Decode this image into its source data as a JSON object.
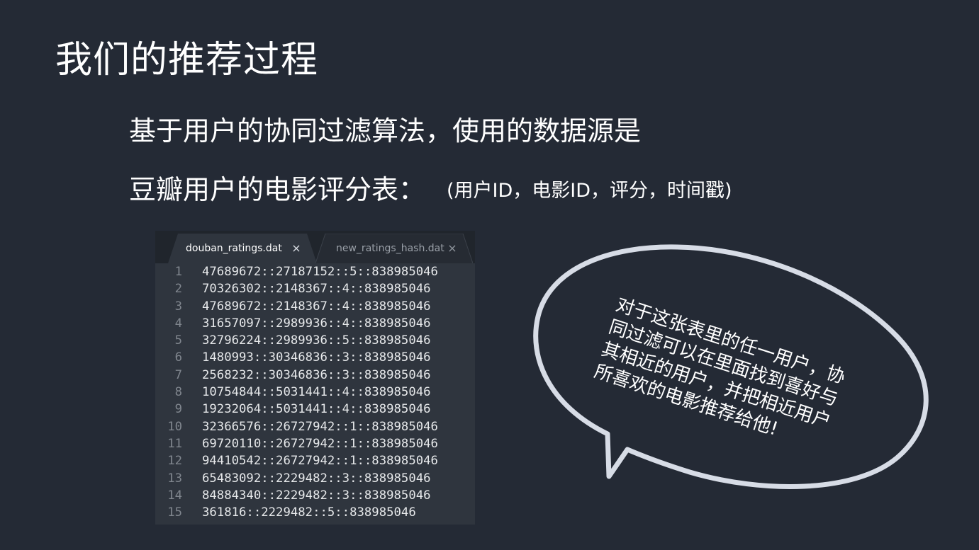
{
  "slide": {
    "title": "我们的推荐过程",
    "line1": "基于用户的协同过滤算法，使用的数据源是",
    "line2_main": "豆瓣用户的电影评分表：",
    "line2_note": "(用户ID，电影ID，评分，时间戳)"
  },
  "editor": {
    "tabs": [
      {
        "label": "douban_ratings.dat",
        "close": "×",
        "active": true
      },
      {
        "label": "new_ratings_hash.dat",
        "close": "×",
        "active": false
      }
    ],
    "lines": [
      {
        "num": "1",
        "text": "47689672::27187152::5::838985046"
      },
      {
        "num": "2",
        "text": "70326302::2148367::4::838985046"
      },
      {
        "num": "3",
        "text": "47689672::2148367::4::838985046"
      },
      {
        "num": "4",
        "text": "31657097::2989936::4::838985046"
      },
      {
        "num": "5",
        "text": "32796224::2989936::5::838985046"
      },
      {
        "num": "6",
        "text": "1480993::30346836::3::838985046"
      },
      {
        "num": "7",
        "text": "2568232::30346836::3::838985046"
      },
      {
        "num": "8",
        "text": "10754844::5031441::4::838985046"
      },
      {
        "num": "9",
        "text": "19232064::5031441::4::838985046"
      },
      {
        "num": "10",
        "text": "32366576::26727942::1::838985046"
      },
      {
        "num": "11",
        "text": "69720110::26727942::1::838985046"
      },
      {
        "num": "12",
        "text": "94410542::26727942::1::838985046"
      },
      {
        "num": "13",
        "text": "65483092::2229482::3::838985046"
      },
      {
        "num": "14",
        "text": "84884340::2229482::3::838985046"
      },
      {
        "num": "15",
        "text": "361816::2229482::5::838985046"
      }
    ]
  },
  "bubble": {
    "lines": [
      "对于这张表里的任一用户，协",
      "同过滤可以在里面找到喜好与",
      "其相近的用户，并把相近用户",
      "所喜欢的电影推荐给他!"
    ]
  },
  "colors": {
    "background": "#242a35",
    "editor_bg": "#2f353e",
    "tab_bar_bg": "#20252c",
    "bubble_stroke": "#d7dce6"
  }
}
